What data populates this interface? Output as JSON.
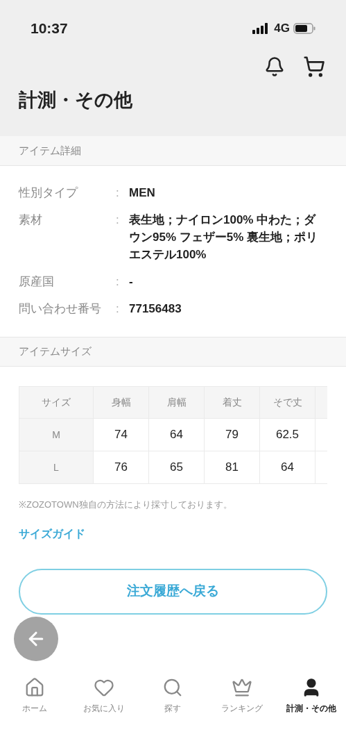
{
  "status_bar": {
    "time": "10:37",
    "network": "4G"
  },
  "header": {
    "title": "計測・その他"
  },
  "item_details": {
    "heading": "アイテム詳細",
    "separator": ":",
    "rows": [
      {
        "label": "性別タイプ",
        "value": "MEN"
      },
      {
        "label": "素材",
        "value": "表生地；ナイロン100% 中わた；ダウン95% フェザー5% 裏生地；ポリエステル100%"
      },
      {
        "label": "原産国",
        "value": "-"
      },
      {
        "label": "問い合わせ番号",
        "value": "77156483"
      }
    ]
  },
  "item_size": {
    "heading": "アイテムサイズ",
    "table": {
      "columns": [
        "サイズ",
        "身幅",
        "肩幅",
        "着丈",
        "そで丈"
      ],
      "rows": [
        [
          "M",
          "74",
          "64",
          "79",
          "62.5"
        ],
        [
          "L",
          "76",
          "65",
          "81",
          "64"
        ]
      ]
    },
    "note": "※ZOZOTOWN独自の方法により採寸しております。",
    "size_guide_link": "サイズガイド"
  },
  "return_button": "注文履歴へ戻る",
  "tab_bar": [
    {
      "kind": "home",
      "label": "ホーム",
      "selected": false
    },
    {
      "kind": "heart",
      "label": "お気に入り",
      "selected": false
    },
    {
      "kind": "search",
      "label": "探す",
      "selected": false
    },
    {
      "kind": "crown",
      "label": "ランキング",
      "selected": false
    },
    {
      "kind": "person",
      "label": "計測・その他",
      "selected": true
    }
  ]
}
